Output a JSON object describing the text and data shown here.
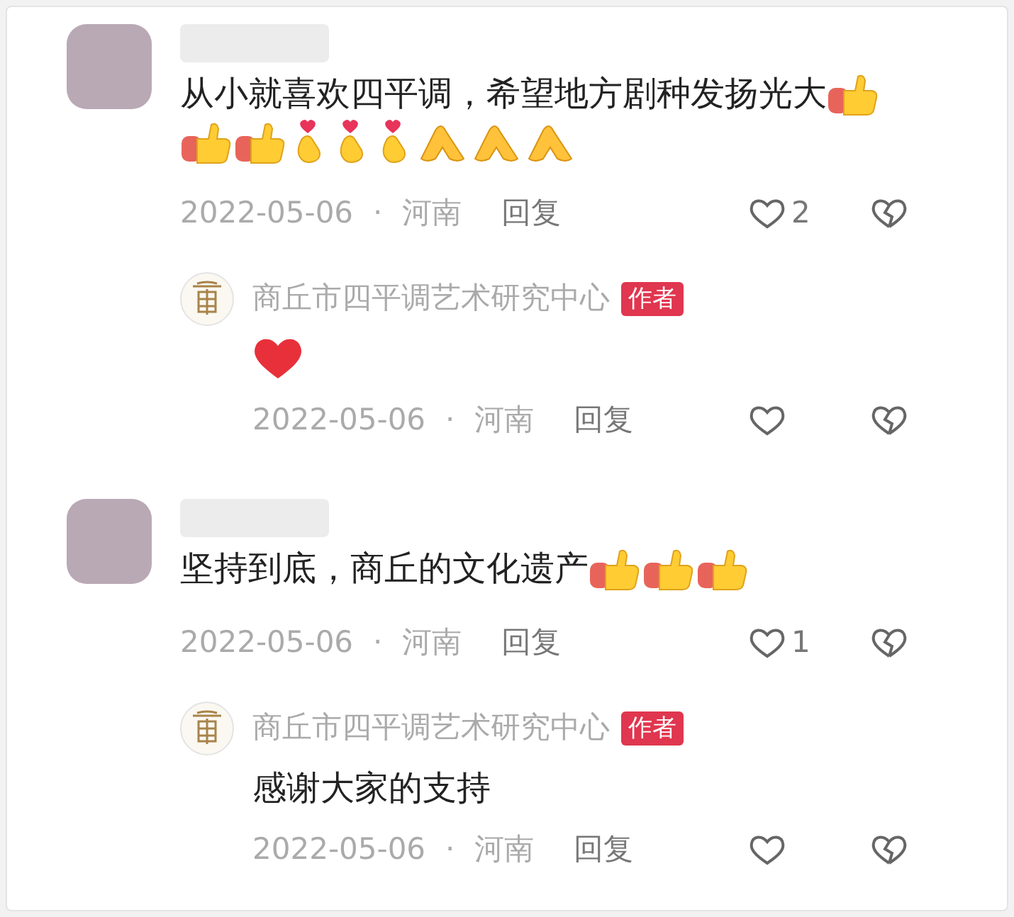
{
  "comments": [
    {
      "text": "从小就喜欢四平调，希望地方剧种发扬光大",
      "emojis": [
        {
          "kind": "thumbs_up"
        },
        {
          "kind": "thumbs_up"
        },
        {
          "kind": "thumbs_up"
        },
        {
          "kind": "finger_heart"
        },
        {
          "kind": "finger_heart"
        },
        {
          "kind": "finger_heart"
        },
        {
          "kind": "palms"
        },
        {
          "kind": "palms"
        },
        {
          "kind": "palms"
        }
      ],
      "date": "2022-05-06",
      "separator": "·",
      "region": "河南",
      "reply_label": "回复",
      "likes": "2",
      "replies": [
        {
          "name": "商丘市四平调艺术研究中心",
          "badge": "作者",
          "emojis": [
            {
              "kind": "red_heart"
            }
          ],
          "date": "2022-05-06",
          "separator": "·",
          "region": "河南",
          "reply_label": "回复"
        }
      ]
    },
    {
      "text": "坚持到底，商丘的文化遗产",
      "emojis": [
        {
          "kind": "thumbs_up"
        },
        {
          "kind": "thumbs_up"
        },
        {
          "kind": "thumbs_up"
        }
      ],
      "date": "2022-05-06",
      "separator": "·",
      "region": "河南",
      "reply_label": "回复",
      "likes": "1",
      "replies": [
        {
          "name": "商丘市四平调艺术研究中心",
          "badge": "作者",
          "text": "感谢大家的支持",
          "date": "2022-05-06",
          "separator": "·",
          "region": "河南",
          "reply_label": "回复"
        }
      ]
    }
  ]
}
